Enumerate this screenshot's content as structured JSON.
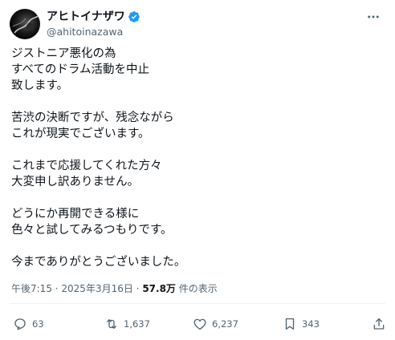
{
  "author": {
    "display_name": "アヒトイナザワ",
    "handle": "@ahitoinazawa",
    "verified": true
  },
  "post": {
    "paragraphs": [
      [
        "ジストニア悪化の為",
        "すべてのドラム活動を中止",
        "致します。"
      ],
      [
        "苦渋の決断ですが、残念ながら",
        "これが現実でございます。"
      ],
      [
        "これまで応援してくれた方々",
        "大変申し訳ありません。"
      ],
      [
        "どうにか再開できる様に",
        "色々と試してみるつもりです。"
      ],
      [
        "今までありがとうございました。"
      ]
    ]
  },
  "meta": {
    "time": "午後7:15",
    "separator": " · ",
    "date": "2025年3月16日",
    "views_count": "57.8万",
    "views_label": " 件の表示"
  },
  "actions": {
    "replies": "63",
    "reposts": "1,637",
    "likes": "6,237",
    "bookmarks": "343"
  },
  "colors": {
    "text": "#0f1419",
    "secondary": "#536471",
    "verified": "#1d9bf0"
  },
  "icons": [
    "more-icon",
    "verified-badge-icon",
    "reply-icon",
    "repost-icon",
    "like-icon",
    "bookmark-icon",
    "share-icon"
  ]
}
